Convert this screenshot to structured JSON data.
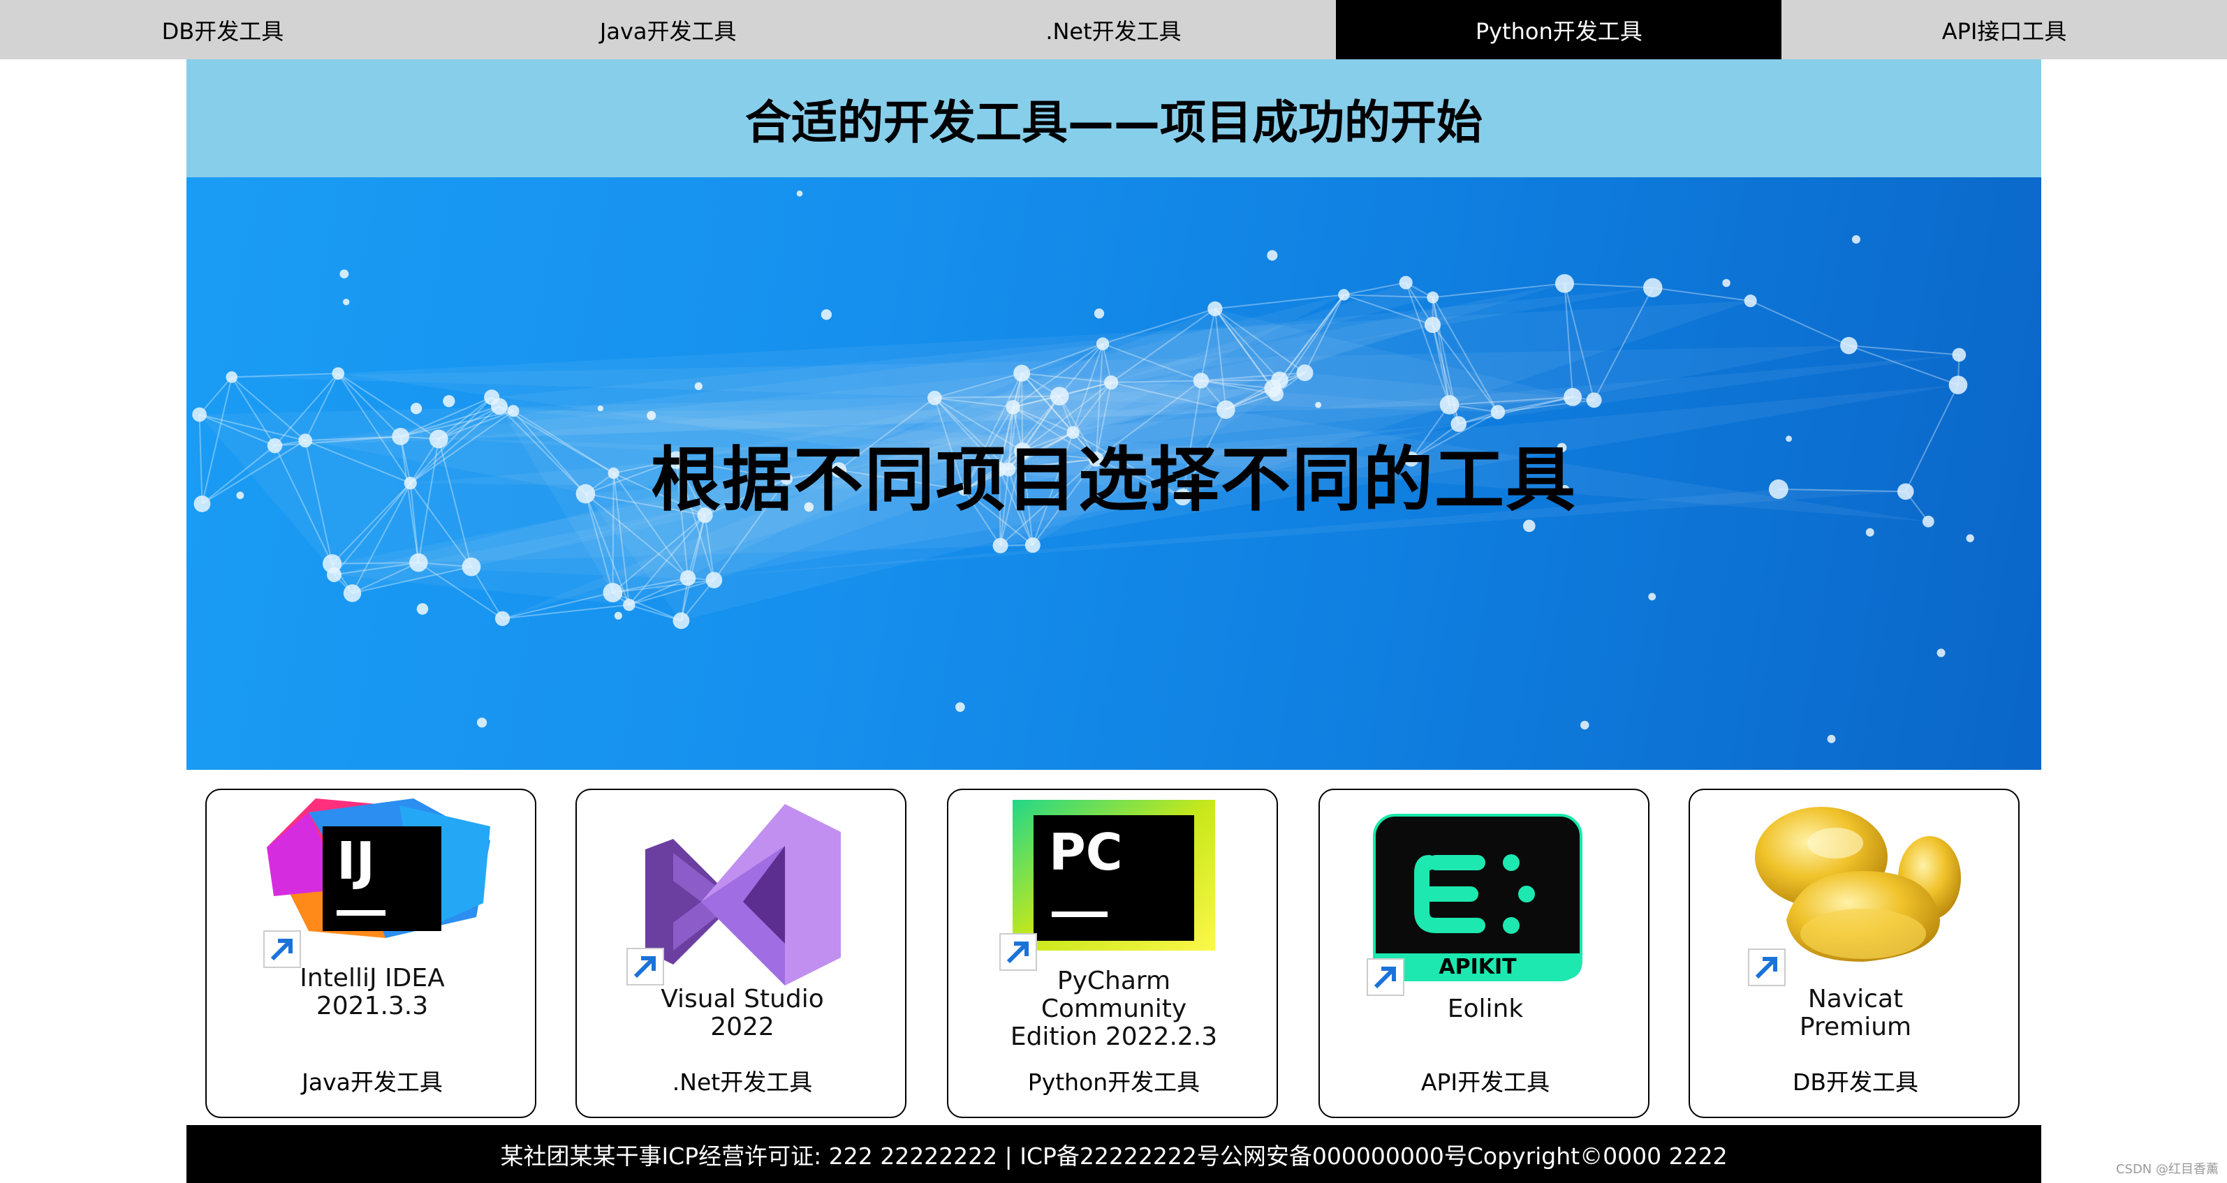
{
  "nav": {
    "items": [
      {
        "label": "DB开发工具"
      },
      {
        "label": "Java开发工具"
      },
      {
        "label": ".Net开发工具"
      },
      {
        "label": "Python开发工具"
      },
      {
        "label": "API接口工具"
      }
    ],
    "active_index": 3
  },
  "header": {
    "title": "合适的开发工具——项目成功的开始"
  },
  "banner": {
    "title": "根据不同项目选择不同的工具"
  },
  "cards": [
    {
      "app_name": "IntelliJ IDEA\n2021.3.3",
      "label": "Java开发工具",
      "icon": "intellij-idea-icon"
    },
    {
      "app_name": "Visual Studio\n2022",
      "label": ".Net开发工具",
      "icon": "visual-studio-icon"
    },
    {
      "app_name": "PyCharm\nCommunity\nEdition 2022.2.3",
      "label": "Python开发工具",
      "icon": "pycharm-icon"
    },
    {
      "app_name": "Eolink",
      "label": "API开发工具",
      "icon": "apikit-icon",
      "icon_text": "APIKIT"
    },
    {
      "app_name": "Navicat\nPremium",
      "label": "DB开发工具",
      "icon": "navicat-icon"
    }
  ],
  "footer": {
    "text": "某社团某某干事ICP经营许可证: 222 22222222 | ICP备22222222号公网安备000000000号Copyright©0000 2222"
  },
  "watermark": "CSDN @红目香薰",
  "colors": {
    "nav_bg": "#d3d3d3",
    "nav_active_bg": "#000000",
    "header_bg": "#87ceeb",
    "banner_blue": "#1690ee",
    "footer_bg": "#000000"
  }
}
